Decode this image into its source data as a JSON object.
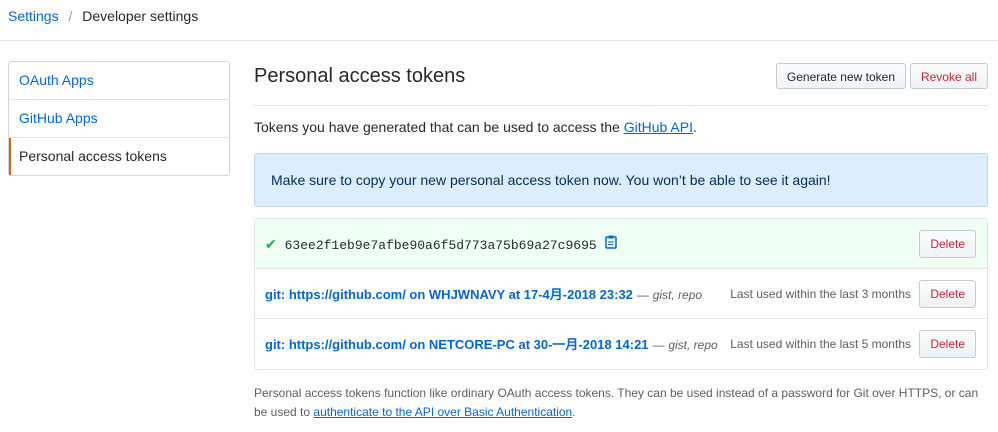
{
  "breadcrumb": {
    "parent": "Settings",
    "separator": "/",
    "current": "Developer settings"
  },
  "sidebar": {
    "items": [
      {
        "label": "OAuth Apps",
        "selected": false
      },
      {
        "label": "GitHub Apps",
        "selected": false
      },
      {
        "label": "Personal access tokens",
        "selected": true
      }
    ]
  },
  "main": {
    "title": "Personal access tokens",
    "generate_button": "Generate new token",
    "revoke_button": "Revoke all",
    "description_prefix": "Tokens you have generated that can be used to access the ",
    "description_link": "GitHub API",
    "description_suffix": ".",
    "flash": "Make sure to copy your new personal access token now. You won’t be able to see it again!",
    "new_token": {
      "value": "63ee2f1eb9e7afbe90a6f5d773a75b69a27c9695",
      "delete_label": "Delete"
    },
    "tokens": [
      {
        "name": "git: https://github.com/ on WHJWNAVY at 17-4月-2018 23:32",
        "dash": "—",
        "scopes": "gist, repo",
        "last_used": "Last used within the last 3 months",
        "delete_label": "Delete"
      },
      {
        "name": "git: https://github.com/ on NETCORE-PC at 30-一月-2018 14:21",
        "dash": "—",
        "scopes": "gist, repo",
        "last_used": "Last used within the last 5 months",
        "delete_label": "Delete"
      }
    ],
    "footer_text": "Personal access tokens function like ordinary OAuth access tokens. They can be used instead of a password for Git over HTTPS, or can be used to ",
    "footer_link": "authenticate to the API over Basic Authentication",
    "footer_suffix": "."
  },
  "colors": {
    "link": "#0366d6",
    "danger": "#cb2431",
    "flash_bg": "#dbedff",
    "success": "#28a745",
    "selected_border": "#e36209"
  },
  "icons": {
    "check": "check-icon",
    "copy": "clipboard-icon"
  }
}
